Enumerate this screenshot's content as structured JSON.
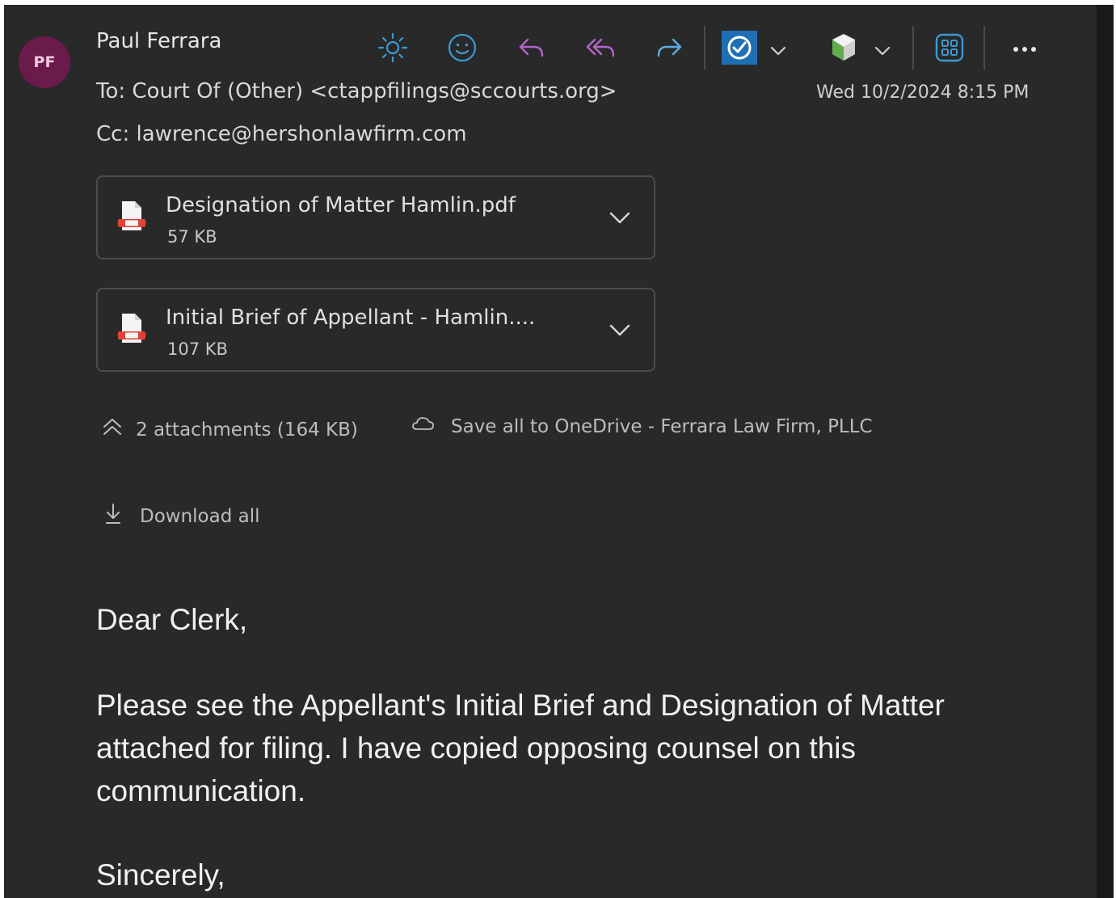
{
  "sender": {
    "initials": "PF",
    "name": "Paul Ferrara"
  },
  "recipients": {
    "to_label": "To:",
    "to": "Court Of (Other) <ctappfilings@sccourts.org>",
    "cc_label": "Cc:",
    "cc": "lawrence@hershonlawfirm.com"
  },
  "date": "Wed 10/2/2024 8:15 PM",
  "toolbar": {
    "icons": [
      "sun-icon",
      "emoji-icon",
      "reply-icon",
      "reply-all-icon",
      "forward-icon",
      "task-check-icon",
      "cube-icon",
      "apps-grid-icon",
      "more-icon"
    ]
  },
  "attachments": [
    {
      "name": "Designation of Matter Hamlin.pdf",
      "size": "57 KB"
    },
    {
      "name": "Initial Brief of Appellant - Hamlin....",
      "size": "107 KB"
    }
  ],
  "attachment_bar": {
    "summary": "2 attachments (164 KB)",
    "save_all": "Save all to OneDrive - Ferrara Law Firm, PLLC",
    "download_all": "Download all"
  },
  "body": {
    "greeting": "Dear Clerk,",
    "paragraph": "Please see the Appellant's Initial Brief and Designation of Matter attached for filing. I have copied opposing counsel on this communication.",
    "closing": "Sincerely,"
  },
  "colors": {
    "background": "#292929",
    "avatar": "#6b1a4c",
    "sun_icon": "#3b9ad6",
    "reply_icons": "#b065c8",
    "forward_icon": "#5aaee0",
    "task_icon": "#1f6fb5"
  }
}
